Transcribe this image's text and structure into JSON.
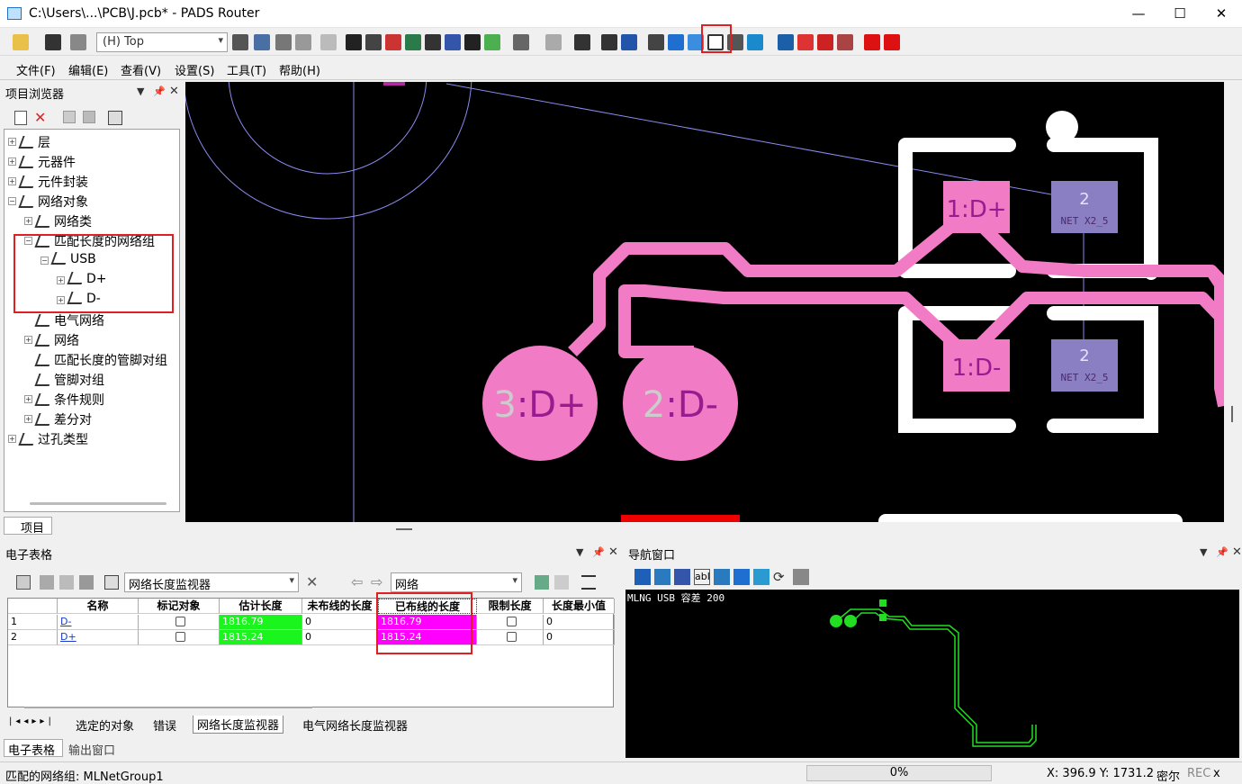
{
  "window": {
    "title": "C:\\Users\\...\\PCB\\J.pcb* - PADS Router",
    "minimize": "—",
    "maximize": "☐",
    "close": "✕"
  },
  "toolbar": {
    "layer_value": "(H) Top"
  },
  "menu": [
    "文件(F)",
    "编辑(E)",
    "查看(V)",
    "设置(S)",
    "工具(T)",
    "帮助(H)"
  ],
  "project_browser": {
    "title": "项目浏览器",
    "tab_label": "项目",
    "tree": [
      {
        "label": "层",
        "level": 0,
        "expander": "+"
      },
      {
        "label": "元器件",
        "level": 0,
        "expander": "+"
      },
      {
        "label": "元件封装",
        "level": 0,
        "expander": "+"
      },
      {
        "label": "网络对象",
        "level": 0,
        "expander": "−"
      },
      {
        "label": "网络类",
        "level": 1,
        "expander": "+"
      },
      {
        "label": "匹配长度的网络组",
        "level": 1,
        "expander": "−"
      },
      {
        "label": "USB",
        "level": 2,
        "expander": "−"
      },
      {
        "label": "D+",
        "level": 3,
        "expander": "+"
      },
      {
        "label": "D-",
        "level": 3,
        "expander": "+"
      },
      {
        "label": "电气网络",
        "level": 1,
        "expander": ""
      },
      {
        "label": "网络",
        "level": 1,
        "expander": "+"
      },
      {
        "label": "匹配长度的管脚对组",
        "level": 1,
        "expander": ""
      },
      {
        "label": "管脚对组",
        "level": 1,
        "expander": ""
      },
      {
        "label": "条件规则",
        "level": 1,
        "expander": "+"
      },
      {
        "label": "差分对",
        "level": 1,
        "expander": "+"
      },
      {
        "label": "过孔类型",
        "level": 0,
        "expander": "+"
      }
    ]
  },
  "pcb": {
    "pads": [
      {
        "label": "3:D+"
      },
      {
        "label": "2:D-"
      },
      {
        "label": "1:D+"
      },
      {
        "label": "1:D-"
      },
      {
        "label": "2",
        "sub": "NET X2_5"
      },
      {
        "label": "2",
        "sub": "NET X2_5"
      }
    ],
    "trace_color": "#f27bc6",
    "pad_blue": "#8b7fc4"
  },
  "spreadsheet": {
    "title": "电子表格",
    "view_select": "网络长度监视器",
    "object_select": "网络",
    "columns": [
      "",
      "名称",
      "标记对象",
      "估计长度",
      "未布线的长度",
      "已布线的长度",
      "限制长度",
      "长度最小值"
    ],
    "rows": [
      {
        "idx": "1",
        "name": "D-",
        "marked": false,
        "est": "1816.79",
        "unrouted": "0",
        "routed": "1816.79",
        "limit": false,
        "min": "0"
      },
      {
        "idx": "2",
        "name": "D+",
        "marked": false,
        "est": "1815.24",
        "unrouted": "0",
        "routed": "1815.24",
        "limit": false,
        "min": "0"
      }
    ],
    "tabs": [
      "选定的对象",
      "错误",
      "网络长度监视器",
      "电气网络长度监视器"
    ],
    "bottom_tabs": [
      "电子表格",
      "输出窗口"
    ]
  },
  "navigator": {
    "title": "导航窗口",
    "info": "MLNG USB 容差 200"
  },
  "status": {
    "left": "匹配的网络组: MLNetGroup1",
    "progress": "0%",
    "coords": "X: 396.9   Y: 1731.2",
    "units": "密尔",
    "rec": "REC",
    "close": "x"
  }
}
